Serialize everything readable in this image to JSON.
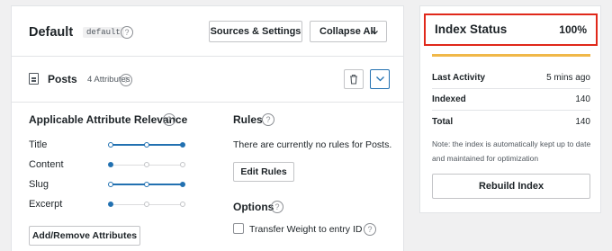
{
  "engine": {
    "title": "Default",
    "slug": "default",
    "help": "?",
    "sources_settings_label": "Sources & Settings",
    "collapse_all_label": "Collapse All"
  },
  "source": {
    "title": "Posts",
    "count": "4 Attributes",
    "help": "?"
  },
  "relevance": {
    "heading": "Applicable Attribute Relevance",
    "help": "?",
    "attributes": [
      {
        "label": "Title",
        "level": 1.0
      },
      {
        "label": "Content",
        "level": 0.0
      },
      {
        "label": "Slug",
        "level": 1.0
      },
      {
        "label": "Excerpt",
        "level": 0.0
      }
    ],
    "add_remove_label": "Add/Remove Attributes"
  },
  "rules": {
    "heading": "Rules",
    "help": "?",
    "empty_text": "There are currently no rules for Posts.",
    "edit_label": "Edit Rules"
  },
  "options": {
    "heading": "Options",
    "help": "?",
    "transfer_weight_label": "Transfer Weight to entry ID",
    "transfer_weight_checked": false
  },
  "index_status": {
    "title": "Index Status",
    "percent": "100%",
    "progress": 1.0,
    "progress_color": "#f0b849",
    "last_activity_label": "Last Activity",
    "last_activity_value": "5 mins ago",
    "indexed_label": "Indexed",
    "indexed_value": "140",
    "total_label": "Total",
    "total_value": "140",
    "note": "Note: the index is automatically kept up to date and maintained for optimization",
    "rebuild_label": "Rebuild Index",
    "highlight_color": "#e0281a"
  },
  "colors": {
    "accent": "#2271b1"
  }
}
